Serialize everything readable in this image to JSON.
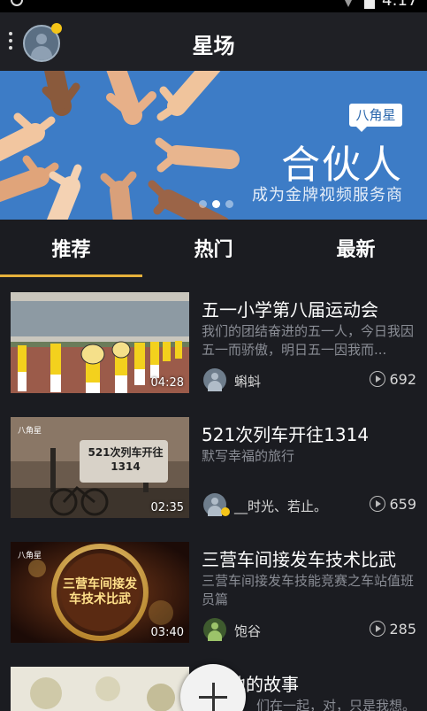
{
  "status_bar": {
    "time": "4:17"
  },
  "header": {
    "title": "星场"
  },
  "banner": {
    "logo_text": "八角星",
    "headline": "合伙人",
    "subline": "成为金牌视频服务商",
    "page_count": 3,
    "active_page": 1,
    "background_color": "#3d7cc6"
  },
  "tabs": [
    {
      "label": "推荐",
      "active": true
    },
    {
      "label": "热门",
      "active": false
    },
    {
      "label": "最新",
      "active": false
    }
  ],
  "accent_color": "#e6b13b",
  "videos": [
    {
      "title": "五一小学第八届运动会",
      "description": "我们的团结奋进的五一人，今日我因五一而骄傲，明日五一因我而...",
      "duration": "04:28",
      "author": "蝌蚪",
      "plays": "692",
      "thumbnail": "sports-parade"
    },
    {
      "title": "521次列车开往1314",
      "description": "默写幸福的旅行",
      "duration": "02:35",
      "author": "__时光、若止。",
      "plays": "659",
      "thumbnail": "train-sign",
      "watermark": "八角星",
      "thumb_text": "521次列车开往1314"
    },
    {
      "title": "三营车间接发车技术比武",
      "description": "三营车间接发车技能竞赛之车站值班员篇",
      "duration": "03:40",
      "author": "饱谷",
      "plays": "285",
      "thumbnail": "gold-emblem",
      "watermark": "八角星",
      "thumb_text": "三营车间接发车技术比武"
    },
    {
      "title": "他的故事",
      "description": "们在一起，对，只是我想。",
      "thumbnail": "partial"
    }
  ]
}
